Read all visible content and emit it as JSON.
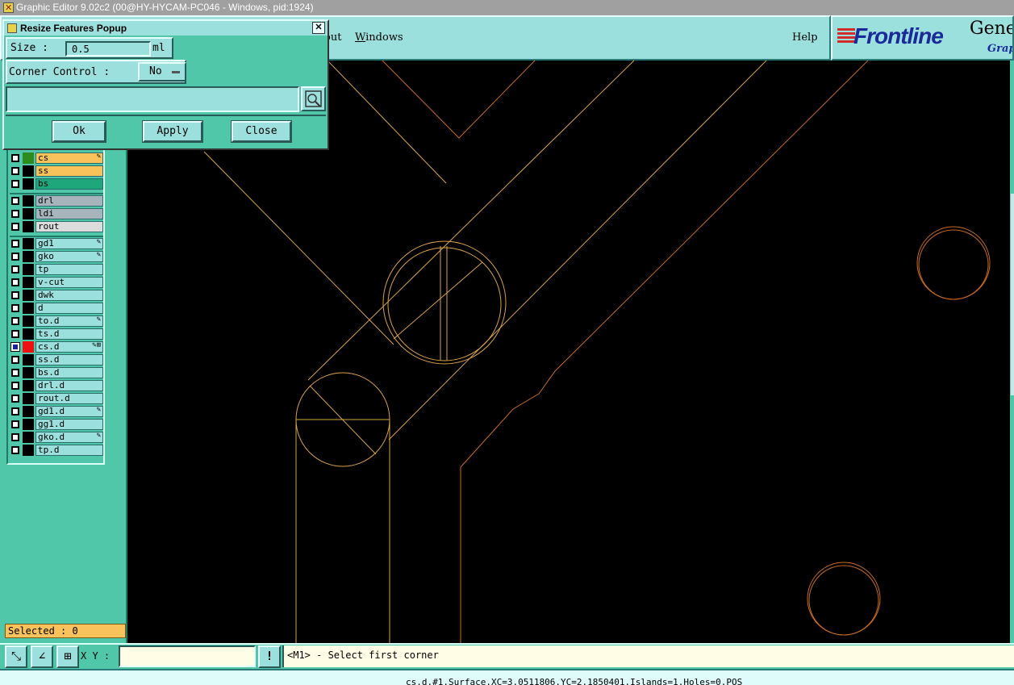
{
  "window": {
    "title": "Graphic Editor 9.02c2 (00@HY-HYCAM-PC046 - Windows, pid:1924)"
  },
  "menubar": {
    "items": [
      {
        "label": "out"
      },
      {
        "mnemonic": "W",
        "rest": "indows"
      },
      {
        "label": "Help"
      }
    ]
  },
  "logo": {
    "brand": "Frontline",
    "product": "Genes",
    "subtitle": "Graph"
  },
  "popup": {
    "title": "Resize Features Popup",
    "close_glyph": "✕",
    "size_label": "Size :",
    "size_value": "0.5",
    "size_unit": "ml",
    "corner_label": "Corner Control :",
    "corner_value": "No",
    "buttons": {
      "ok": "Ok",
      "apply": "Apply",
      "close": "Close"
    }
  },
  "layers": [
    {
      "name": "cs",
      "color": "#f9c25a",
      "swatch": "#2e8b1f",
      "mark": "✎"
    },
    {
      "name": "ss",
      "color": "#f9c25a",
      "swatch": "#000000",
      "mark": ""
    },
    {
      "name": "bs",
      "color": "#1fa77c",
      "swatch": "#000000",
      "mark": ""
    },
    {
      "name": "drl",
      "color": "#a8b4bc",
      "swatch": "#000000",
      "mark": ""
    },
    {
      "name": "ldi",
      "color": "#a8b4bc",
      "swatch": "#000000",
      "mark": ""
    },
    {
      "name": "rout",
      "color": "#dcdcdc",
      "swatch": "#000000",
      "mark": ""
    },
    {
      "name": "gd1",
      "color": "#9be0dc",
      "swatch": "#000000",
      "mark": "✎"
    },
    {
      "name": "gko",
      "color": "#9be0dc",
      "swatch": "#000000",
      "mark": "✎"
    },
    {
      "name": "tp",
      "color": "#9be0dc",
      "swatch": "#000000",
      "mark": ""
    },
    {
      "name": "v-cut",
      "color": "#9be0dc",
      "swatch": "#000000",
      "mark": ""
    },
    {
      "name": "dwk",
      "color": "#9be0dc",
      "swatch": "#000000",
      "mark": ""
    },
    {
      "name": "d",
      "color": "#9be0dc",
      "swatch": "#000000",
      "mark": ""
    },
    {
      "name": "to.d",
      "color": "#9be0dc",
      "swatch": "#000000",
      "mark": "✎"
    },
    {
      "name": "ts.d",
      "color": "#9be0dc",
      "swatch": "#000000",
      "mark": ""
    },
    {
      "name": "cs.d",
      "color": "#9be0dc",
      "swatch": "#ee1111",
      "mark": "✎⊞",
      "active": true
    },
    {
      "name": "ss.d",
      "color": "#9be0dc",
      "swatch": "#000000",
      "mark": ""
    },
    {
      "name": "bs.d",
      "color": "#9be0dc",
      "swatch": "#000000",
      "mark": ""
    },
    {
      "name": "drl.d",
      "color": "#9be0dc",
      "swatch": "#000000",
      "mark": ""
    },
    {
      "name": "rout.d",
      "color": "#9be0dc",
      "swatch": "#000000",
      "mark": ""
    },
    {
      "name": "gd1.d",
      "color": "#9be0dc",
      "swatch": "#000000",
      "mark": "✎"
    },
    {
      "name": "gg1.d",
      "color": "#9be0dc",
      "swatch": "#000000",
      "mark": ""
    },
    {
      "name": "gko.d",
      "color": "#9be0dc",
      "swatch": "#000000",
      "mark": "✎"
    },
    {
      "name": "tp.d",
      "color": "#9be0dc",
      "swatch": "#000000",
      "mark": ""
    }
  ],
  "selected": {
    "label": "Selected : 0"
  },
  "bottom": {
    "xy_label": "X Y :",
    "xy_value": "",
    "exclaim": "!",
    "prompt": "<M1> - Select first corner"
  },
  "status": {
    "text": "cs.d.#1.Surface.XC=3.0511806.YC=2.1850401.Islands=1.Holes=0.POS"
  },
  "colors": {
    "feature_orange": "#c86a1e",
    "feature_yellow": "#d9a24a",
    "canvas": "#000000",
    "panel": "#4fc7a8"
  }
}
